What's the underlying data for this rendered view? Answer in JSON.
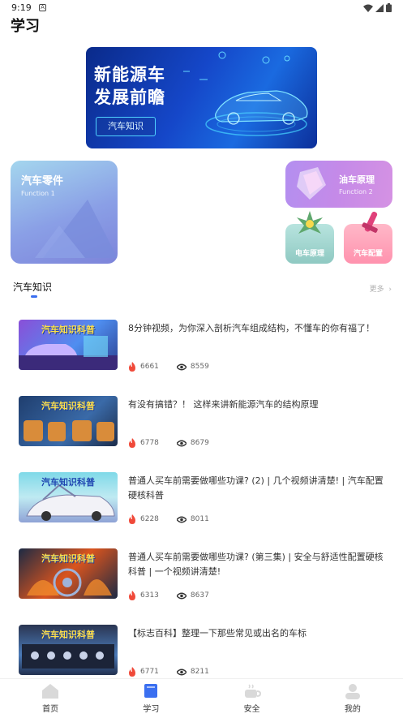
{
  "status_bar": {
    "time": "9:19",
    "notification": "A"
  },
  "page": {
    "title": "学习"
  },
  "banner": {
    "title_line1": "新能源车",
    "title_line2": "发展前瞻",
    "button_label": "汽车知识"
  },
  "categories": {
    "left": {
      "title": "汽车零件",
      "subtitle": "Function 1"
    },
    "right_top": {
      "title": "油车原理",
      "subtitle": "Function 2"
    },
    "small1": {
      "label": "电车原理"
    },
    "small2": {
      "label": "汽车配置"
    }
  },
  "section": {
    "title": "汽车知识",
    "more": "更多"
  },
  "videos": [
    {
      "title": "8分钟视频，为你深入剖析汽车组成结构，不懂车的你有福了！",
      "likes": "6661",
      "views": "8559",
      "thumb_text": "汽车知识科普"
    },
    {
      "title": "有没有搞错？！ 这样来讲新能源汽车的结构原理",
      "likes": "6778",
      "views": "8679",
      "thumb_text": "汽车知识科普"
    },
    {
      "title": "普通人买车前需要做哪些功课? (2) | 几个视频讲清楚! | 汽车配置硬核科普",
      "likes": "6228",
      "views": "8011",
      "thumb_text": "汽车知识科普"
    },
    {
      "title": "普通人买车前需要做哪些功课? (第三集) | 安全与舒适性配置硬核科普 | 一个视频讲清楚!",
      "likes": "6313",
      "views": "8637",
      "thumb_text": "汽车知识科普"
    },
    {
      "title": "【标志百科】整理一下那些常见或出名的车标",
      "likes": "6771",
      "views": "8211",
      "thumb_text": "汽车知识科普"
    }
  ],
  "tabs": [
    {
      "label": "首页",
      "icon": "home-icon",
      "active": false
    },
    {
      "label": "学习",
      "icon": "book-icon",
      "active": true
    },
    {
      "label": "安全",
      "icon": "cup-icon",
      "active": false
    },
    {
      "label": "我的",
      "icon": "user-icon",
      "active": false
    }
  ],
  "colors": {
    "accent": "#3a6ff0",
    "fire": "#f04a3a",
    "text_gray": "#666666"
  }
}
